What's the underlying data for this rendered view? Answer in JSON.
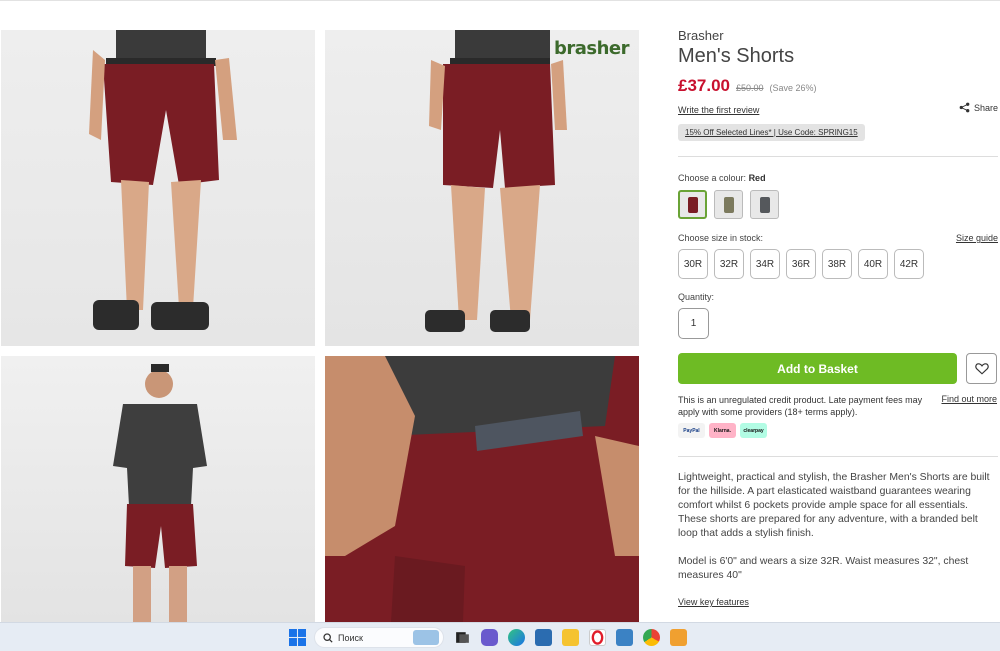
{
  "product": {
    "brand": "Brasher",
    "title": "Men's Shorts",
    "price": "£37.00",
    "was_price": "£50.00",
    "save": "(Save 26%)",
    "review_link": "Write the first review",
    "share_label": "Share",
    "promo": "15% Off Selected Lines* | Use Code: SPRING15",
    "watermark": "brasher"
  },
  "colour": {
    "label": "Choose a colour:",
    "selected": "Red",
    "swatches": [
      {
        "name": "Red",
        "color": "#7a1d24"
      },
      {
        "name": "Khaki",
        "color": "#7c7a5e"
      },
      {
        "name": "Grey",
        "color": "#55585c"
      }
    ]
  },
  "size": {
    "label": "Choose size in stock:",
    "guide": "Size guide",
    "options": [
      "30R",
      "32R",
      "34R",
      "36R",
      "38R",
      "40R",
      "42R"
    ]
  },
  "quantity": {
    "label": "Quantity:",
    "value": "1"
  },
  "basket": {
    "add_label": "Add to Basket",
    "wishlist_icon": "heart-icon"
  },
  "credit": {
    "text": "This is an unregulated credit product. Late payment fees may apply with some providers (18+ terms apply).",
    "link": "Find out more",
    "providers": [
      "PayPal",
      "Klarna.",
      "clearpay"
    ]
  },
  "description": {
    "body": "Lightweight, practical and stylish, the Brasher Men's Shorts are built for the hillside. A part elasticated waistband guarantees wearing comfort whilst 6 pockets provide ample space for all essentials. These shorts are prepared for any adventure, with a branded belt loop that adds a stylish finish.",
    "model": "Model is 6'0\" and wears a size 32R. Waist measures 32\", chest measures 40\"",
    "key_features": "View key features"
  },
  "taskbar": {
    "search_placeholder": "Поиск"
  },
  "colors": {
    "price_red": "#c8102e",
    "basket_green": "#6ebb24",
    "shorts_red": "#7a1d24"
  }
}
